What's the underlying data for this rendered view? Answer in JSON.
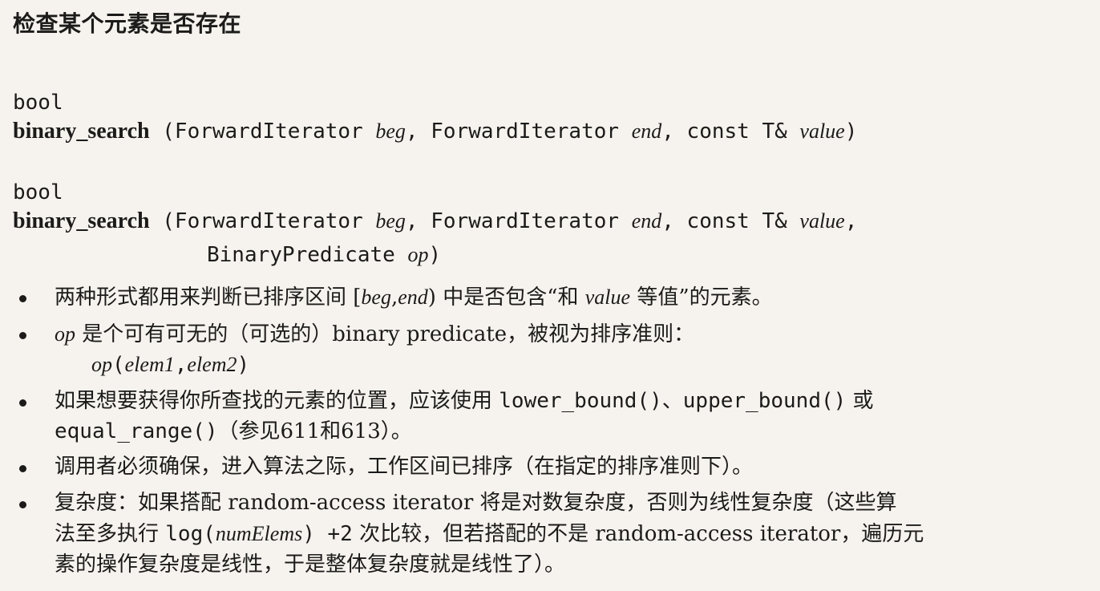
{
  "title": "检查某个元素是否存在",
  "signature1": {
    "ret": "bool",
    "name": "binary_search",
    "open": " (ForwardIterator ",
    "p1": "beg",
    "mid1": ", ForwardIterator ",
    "p2": "end",
    "mid2": ", const T& ",
    "p3": "value",
    "close": ")"
  },
  "signature2": {
    "ret": "bool",
    "name": "binary_search",
    "open": " (ForwardIterator ",
    "p1": "beg",
    "mid1": ", ForwardIterator ",
    "p2": "end",
    "mid2": ", const T& ",
    "p3": "value",
    "mid3": ",",
    "cont": "BinaryPredicate ",
    "p4": "op",
    "close": ")"
  },
  "bullets": {
    "b1": {
      "t1": "两种形式都用来判断已排序区间 [",
      "i1": "beg",
      "t2": ",",
      "i2": "end",
      "t3": ") 中是否包含“和 ",
      "i3": "value",
      "t4": " 等值”的元素。"
    },
    "b2": {
      "i1": "op",
      "t1": " 是个可有可无的（可选的）binary predicate，被视为排序准则：",
      "sub_i1": "op",
      "sub_t1": "(",
      "sub_i2": "elem1",
      "sub_t2": ",",
      "sub_i3": "elem2",
      "sub_t3": ")"
    },
    "b3": {
      "t1": "如果想要获得你所查找的元素的位置，应该使用 ",
      "c1": "lower_bound()",
      "t2": "、",
      "c2": "upper_bound()",
      "t3": " 或",
      "c3": "equal_range()",
      "t4": "（参见611和613）。"
    },
    "b4": {
      "t1": "调用者必须确保，进入算法之际，工作区间已排序（在指定的排序准则下）。"
    },
    "b5": {
      "t1": "复杂度：如果搭配 random-access iterator 将是对数复杂度，否则为线性复杂度（这些算",
      "t2": "法至多执行 ",
      "c1": "log(",
      "i1": "numElems",
      "c2": ") +2",
      "t3": " 次比较，但若搭配的不是 random-access iterator，遍历元",
      "t4": "素的操作复杂度是线性，于是整体复杂度就是线性了）。"
    }
  }
}
